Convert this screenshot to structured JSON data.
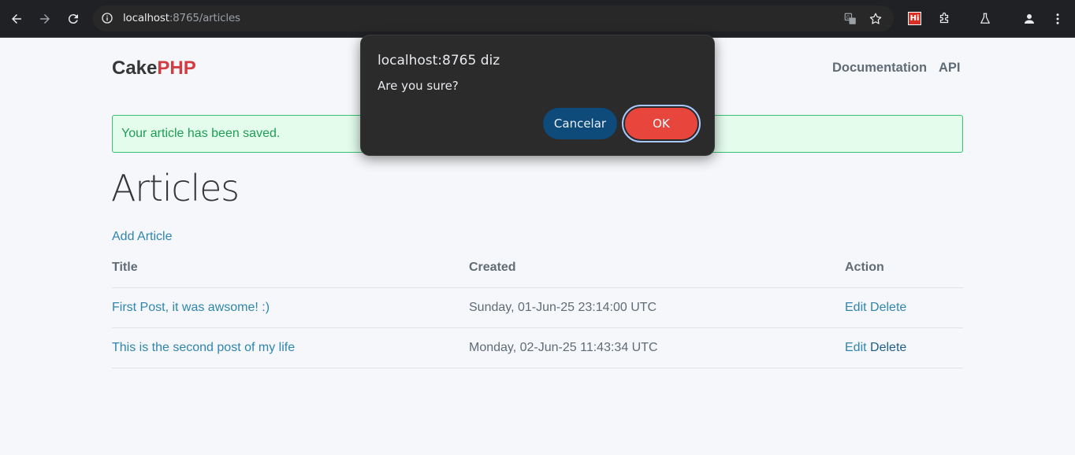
{
  "browser": {
    "url_host": "localhost",
    "url_rest": ":8765/articles"
  },
  "header": {
    "brand_cake": "Cake",
    "brand_php": "PHP",
    "nav_documentation": "Documentation",
    "nav_api": "API"
  },
  "flash": {
    "message": "Your article has been saved."
  },
  "main": {
    "heading": "Articles",
    "add_article": "Add Article",
    "columns": [
      "Title",
      "Created",
      "Action"
    ],
    "rows": [
      {
        "title": "First Post, it was awsome! :)",
        "created": "Sunday, 01-Jun-25 23:14:00 UTC",
        "edit": "Edit",
        "delete": "Delete"
      },
      {
        "title": "This is the second post of my life",
        "created": "Monday, 02-Jun-25 11:43:34 UTC",
        "edit": "Edit",
        "delete": "Delete"
      }
    ]
  },
  "dialog": {
    "title": "localhost:8765 diz",
    "message": "Are you sure?",
    "cancel_label": "Cancelar",
    "ok_label": "OK"
  },
  "colors": {
    "brand_red": "#d33c43",
    "link": "#2f85ae",
    "flash_bg": "#e3fcec",
    "flash_text": "#1f9d55",
    "ok_button": "#e8453c",
    "cancel_button": "#0e4a7a"
  }
}
